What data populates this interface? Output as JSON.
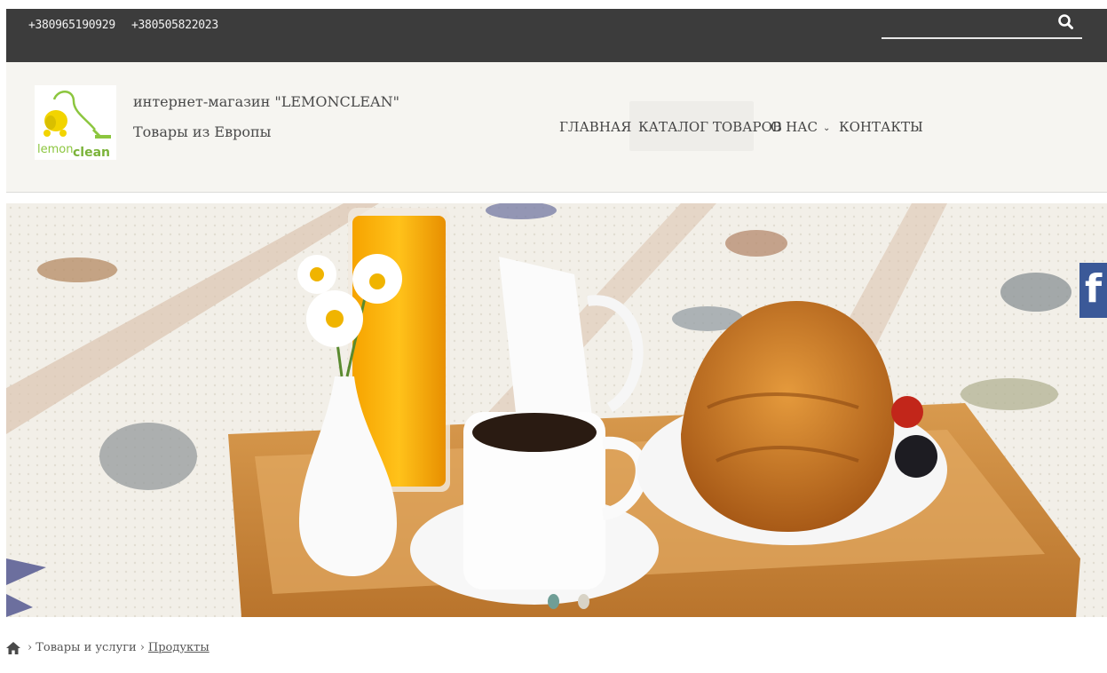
{
  "topbar": {
    "phone_1": "+380965190929",
    "phone_2": "+380505822023",
    "search_placeholder": ""
  },
  "header": {
    "logo_word_1": "lemon",
    "logo_word_2": "clean",
    "site_title": "интернет-магазин \"LEMONCLEAN\"",
    "site_subtitle": "Товары из Европы"
  },
  "nav": {
    "home": "ГЛАВНАЯ",
    "catalog": "КАТАЛОГ ТОВАРОВ",
    "about": "О НАС",
    "contacts": "КОНТАКТЫ"
  },
  "slider": {
    "current_slide": 1,
    "slide_count": 2
  },
  "social": {
    "facebook": "f"
  },
  "breadcrumb": {
    "items": [
      "Товары и услуги"
    ],
    "current": "Продукты"
  },
  "colors": {
    "topbar": "#3c3c3c",
    "header": "#f6f5f1",
    "logo_green": "#8cc63f",
    "logo_yellow": "#f2d400",
    "facebook": "#3b5998",
    "dot_active": "#6f9e96"
  }
}
